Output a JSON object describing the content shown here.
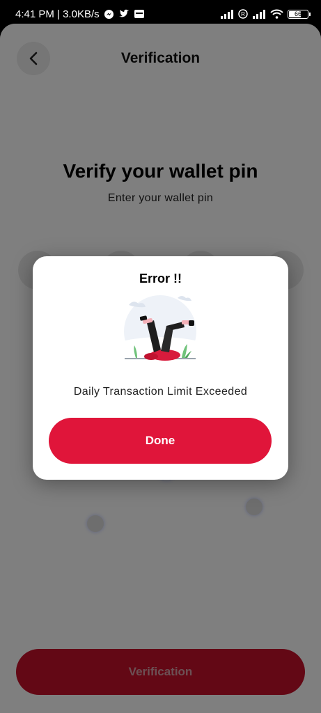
{
  "status_bar": {
    "time_speed": "4:41 PM | 3.0KB/s",
    "battery": "66"
  },
  "header": {
    "title": "Verification"
  },
  "main": {
    "heading": "Verify your wallet pin",
    "subheading": "Enter your wallet pin",
    "verify_button_label": "Verification"
  },
  "dialog": {
    "title": "Error !!",
    "message": "Daily Transaction Limit Exceeded",
    "done_label": "Done",
    "illustration_icon": "fallen-person-illustration"
  },
  "colors": {
    "primary": "#e0153a",
    "dim_overlay": "rgba(0,0,0,0.5)"
  }
}
